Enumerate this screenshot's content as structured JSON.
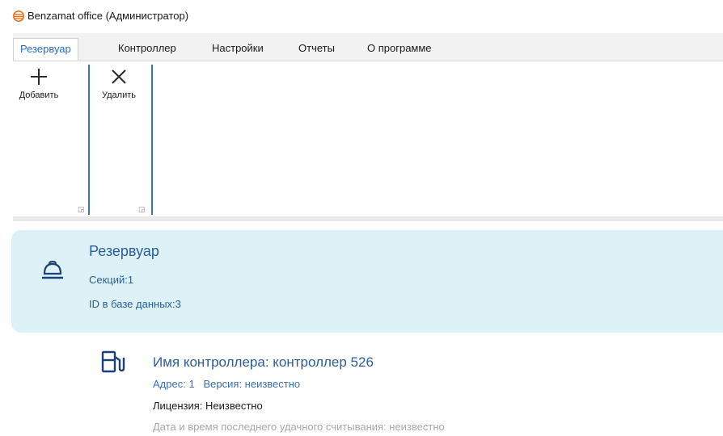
{
  "window": {
    "title": "Benzamat office (Администратор)"
  },
  "tabs": [
    {
      "label": "Резервуар",
      "active": true
    },
    {
      "label": "Контроллер",
      "active": false
    },
    {
      "label": "Настройки",
      "active": false
    },
    {
      "label": "Отчеты",
      "active": false
    },
    {
      "label": "О программе",
      "active": false
    }
  ],
  "ribbon": {
    "add_label": "Добавить",
    "delete_label": "Удалить"
  },
  "tank": {
    "title": "Резервуар",
    "sections": "Секций:1",
    "db_id": "ID в базе данных:3"
  },
  "controller": {
    "name": "Имя контроллера: контроллер 526",
    "address_version": "Адрес: 1   Версия: неизвестно",
    "license": "Лицензия: Неизвестно",
    "last_read": "Дата и время последнего удачного считывания: неизвестно"
  },
  "colors": {
    "accent": "#2b6cc4",
    "card_bg": "#ddf2f6",
    "text_blue": "#2b5d9a",
    "separator": "#3d6fb6"
  },
  "icons": [
    "app-logo-icon",
    "plus-icon",
    "close-icon",
    "dialog-launcher-icon",
    "tank-icon",
    "fuel-pump-icon"
  ]
}
